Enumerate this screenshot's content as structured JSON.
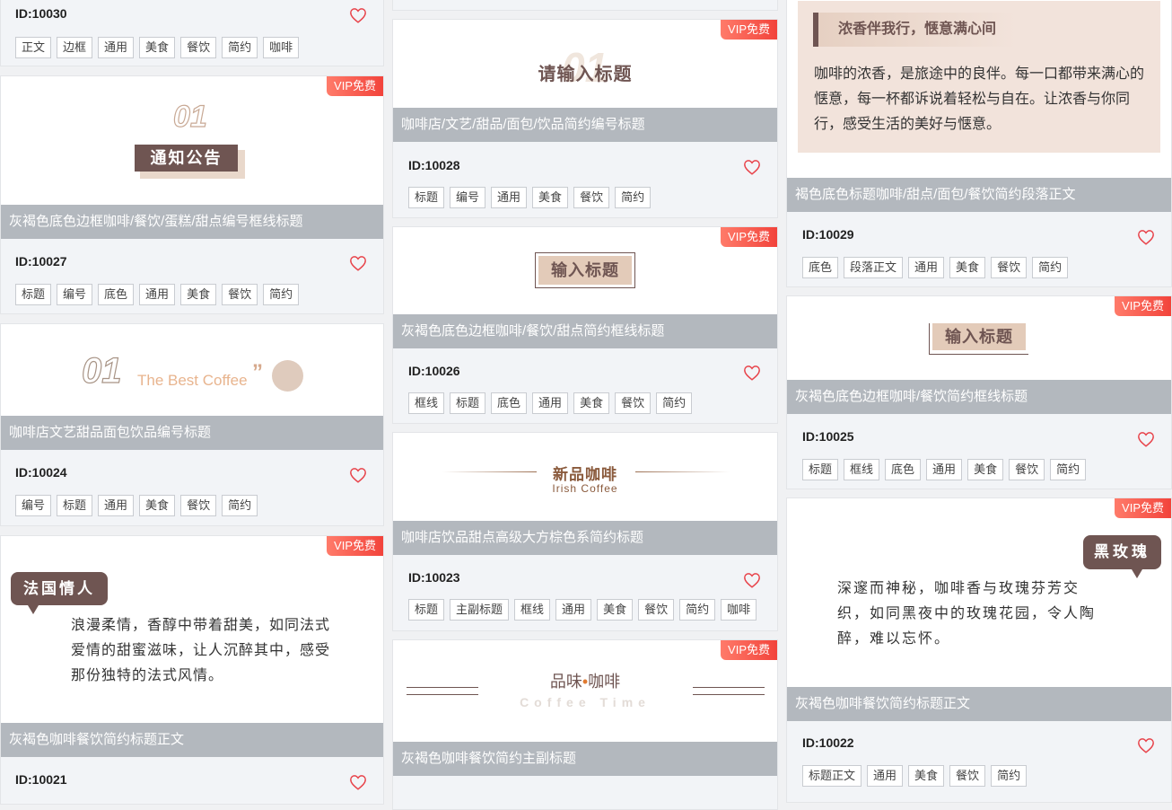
{
  "badge": "VIP免费",
  "cards": {
    "c10030": {
      "id": "ID:10030",
      "tags": [
        "正文",
        "边框",
        "通用",
        "美食",
        "餐饮",
        "简约",
        "咖啡"
      ]
    },
    "c10027": {
      "num": "01",
      "heading": "通知公告",
      "title": "灰褐色底色边框咖啡/餐饮/蛋糕/甜点编号框线标题",
      "id": "ID:10027",
      "tags": [
        "标题",
        "编号",
        "底色",
        "通用",
        "美食",
        "餐饮",
        "简约"
      ]
    },
    "c10024": {
      "num": "01",
      "sub": "The Best Coffee",
      "quote": "”",
      "title": "咖啡店文艺甜品面包饮品编号标题",
      "id": "ID:10024",
      "tags": [
        "编号",
        "标题",
        "通用",
        "美食",
        "餐饮",
        "简约"
      ]
    },
    "c10021": {
      "bubble": "法国情人",
      "body": "浪漫柔情，香醇中带着甜美，如同法式爱情的甜蜜滋味，让人沉醉其中，感受那份独特的法式风情。",
      "title": "灰褐色咖啡餐饮简约标题正文",
      "id": "ID:10021"
    },
    "c10028": {
      "heading": "请输入标题",
      "watermark": "01",
      "title": "咖啡店/文艺/甜品/面包/饮品简约编号标题",
      "id": "ID:10028",
      "tags": [
        "标题",
        "编号",
        "通用",
        "美食",
        "餐饮",
        "简约"
      ]
    },
    "c10026": {
      "heading": "输入标题",
      "title": "灰褐色底色边框咖啡/餐饮/甜点简约框线标题",
      "id": "ID:10026",
      "tags": [
        "框线",
        "标题",
        "底色",
        "通用",
        "美食",
        "餐饮",
        "简约"
      ]
    },
    "c10023": {
      "heading": "新品咖啡",
      "sub": "Irish Coffee",
      "title": "咖啡店饮品甜点高级大方棕色系简约标题",
      "id": "ID:10023",
      "tags": [
        "标题",
        "主副标题",
        "框线",
        "通用",
        "美食",
        "餐饮",
        "简约",
        "咖啡"
      ]
    },
    "c10020": {
      "heading_a": "品味",
      "dot": "•",
      "heading_b": "咖啡",
      "sub": "Coffee Time",
      "title": "灰褐色咖啡餐饮简约主副标题"
    },
    "c10029": {
      "heading": "浓香伴我行，惬意满心间",
      "body": "咖啡的浓香，是旅途中的良伴。每一口都带来满心的惬意，每一杯都诉说着轻松与自在。让浓香与你同行，感受生活的美好与惬意。",
      "title": "褐色底色标题咖啡/甜点/面包/餐饮简约段落正文",
      "id": "ID:10029",
      "tags": [
        "底色",
        "段落正文",
        "通用",
        "美食",
        "餐饮",
        "简约"
      ]
    },
    "c10025": {
      "heading": "输入标题",
      "title": "灰褐色底色边框咖啡/餐饮简约框线标题",
      "id": "ID:10025",
      "tags": [
        "标题",
        "框线",
        "底色",
        "通用",
        "美食",
        "餐饮",
        "简约"
      ]
    },
    "c10022": {
      "bubble": "黑玫瑰",
      "body": "深邃而神秘，咖啡香与玫瑰芬芳交织，如同黑夜中的玫瑰花园，令人陶醉，难以忘怀。",
      "title": "灰褐色咖啡餐饮简约标题正文",
      "id": "ID:10022",
      "tags": [
        "标题正文",
        "通用",
        "美食",
        "餐饮",
        "简约"
      ]
    }
  },
  "icons": {
    "favorite": "heart-outline-icon"
  },
  "colors": {
    "accent_red": "#f2433b",
    "brown_dark": "#6f5552",
    "beige": "#e3cbb9",
    "title_gray": "#b3b8be"
  }
}
